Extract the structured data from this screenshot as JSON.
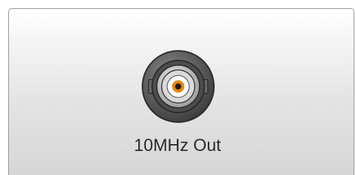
{
  "port": {
    "label": "10MHz Out",
    "icon": "bnc-connector-icon"
  },
  "colors": {
    "panel_border": "#8f8f8f",
    "connector_body": "#5e5e5e",
    "connector_ring": "#b9b9b9",
    "center_pin_ring": "#e08a1e",
    "label_text": "#2a2a2a"
  }
}
